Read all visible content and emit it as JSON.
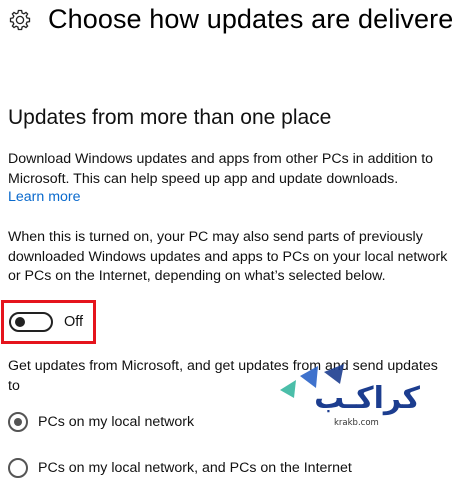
{
  "header": {
    "icon": "gear-icon",
    "title": "Choose how updates are delivered"
  },
  "section": {
    "title": "Updates from more than one place",
    "description": "Download Windows updates and apps from other PCs in addition to Microsoft. This can help speed up app and update downloads.",
    "learn_more": "Learn more",
    "explanation": "When this is turned on, your PC may also send parts of previously downloaded Windows updates and apps to PCs on your local network or PCs on the Internet, depending on what’s selected below."
  },
  "toggle": {
    "label": "Off",
    "state": "off"
  },
  "source_prompt": "Get updates from Microsoft, and get updates from and send updates to",
  "options": [
    {
      "label": "PCs on my local network",
      "selected": true
    },
    {
      "label": "PCs on my local network, and PCs on the Internet",
      "selected": false
    }
  ],
  "watermark": {
    "logo_text": "كراكـب",
    "domain": "krakb.com"
  },
  "colors": {
    "link": "#0a6acd",
    "highlight_border": "#e5141d",
    "watermark_teal": "#2bb39a",
    "watermark_blue": "#2a63c8",
    "watermark_navy": "#1c3d8f"
  }
}
